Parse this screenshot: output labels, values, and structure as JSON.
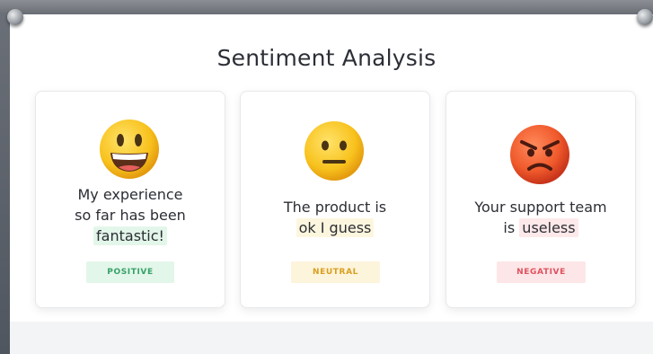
{
  "title": "Sentiment Analysis",
  "cards": [
    {
      "emoji": "grinning-face-icon",
      "line1": "My experience",
      "line2": "so far has been",
      "highlight": "fantastic!",
      "badge": "POSITIVE"
    },
    {
      "emoji": "neutral-face-icon",
      "line1": "The product is",
      "highlight": "ok I guess",
      "badge": "NEUTRAL"
    },
    {
      "emoji": "angry-face-icon",
      "line1": "Your support team",
      "line2_prefix": "is",
      "highlight": "useless",
      "badge": "NEGATIVE"
    }
  ],
  "colors": {
    "positive": "#36a168",
    "neutral": "#d99f1e",
    "negative": "#e0525e"
  }
}
